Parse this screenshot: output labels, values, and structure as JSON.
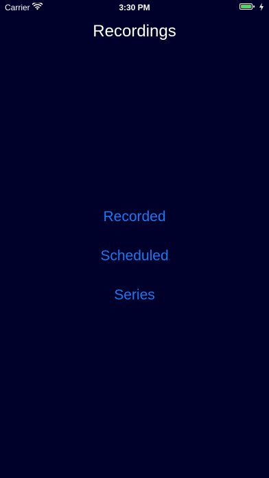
{
  "status_bar": {
    "carrier": "Carrier",
    "time": "3:30 PM",
    "battery_color": "#4cd964",
    "wifi_icon": "wifi-icon",
    "charge_icon": "charging-bolt-icon"
  },
  "header": {
    "title": "Recordings"
  },
  "menu": {
    "items": [
      {
        "label": "Recorded"
      },
      {
        "label": "Scheduled"
      },
      {
        "label": "Series"
      }
    ]
  },
  "colors": {
    "background": "#00012b",
    "link": "#1a78f0",
    "text": "#ffffff"
  }
}
